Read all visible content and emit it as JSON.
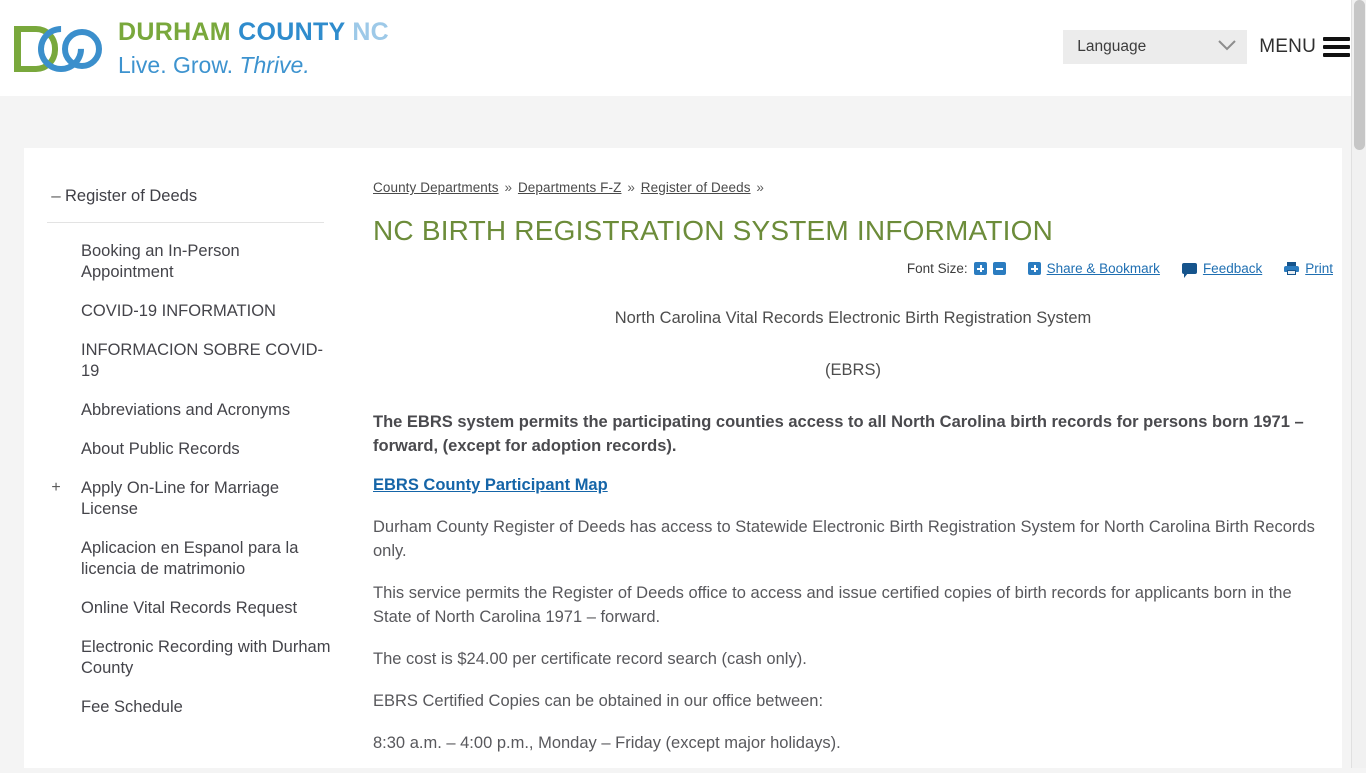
{
  "header": {
    "logo": {
      "mark_alt": "durham-county-dco-logo",
      "line1_part1": "DURHAM ",
      "line1_part2": "COUNTY ",
      "line1_part3": "NC",
      "line2_part1": "Live. Grow. ",
      "line2_part2": "Thrive."
    },
    "language_select": {
      "label": "Language",
      "icon": "chevron-down-icon"
    },
    "menu": {
      "label": "MENU",
      "icon": "hamburger-icon"
    }
  },
  "sidebar": {
    "root": {
      "toggle": "–",
      "label": "Register of Deeds"
    },
    "items": [
      {
        "label": "Booking an In-Person Appointment",
        "toggle": ""
      },
      {
        "label": "COVID-19 INFORMATION",
        "toggle": ""
      },
      {
        "label": "INFORMACION SOBRE COVID-19",
        "toggle": ""
      },
      {
        "label": "Abbreviations and Acronyms",
        "toggle": ""
      },
      {
        "label": "About Public Records",
        "toggle": ""
      },
      {
        "label": "Apply On-Line for Marriage License",
        "toggle": "+"
      },
      {
        "label": "Aplicacion en Espanol para la licencia de matrimonio",
        "toggle": ""
      },
      {
        "label": "Online Vital Records Request",
        "toggle": ""
      },
      {
        "label": "Electronic Recording with Durham County",
        "toggle": ""
      },
      {
        "label": "Fee Schedule",
        "toggle": ""
      }
    ]
  },
  "main": {
    "breadcrumb": {
      "items": [
        "County Departments",
        "Departments F-Z",
        "Register of Deeds"
      ],
      "separator": "»"
    },
    "title": "NC BIRTH REGISTRATION SYSTEM INFORMATION",
    "tools": {
      "font_size_label": "Font Size:",
      "increase_icon": "font-size-increase-icon",
      "decrease_icon": "font-size-decrease-icon",
      "share_icon": "share-plus-icon",
      "share_label": "Share & Bookmark",
      "feedback_icon": "feedback-speech-bubble-icon",
      "feedback_label": "Feedback",
      "print_icon": "printer-icon",
      "print_label": "Print"
    },
    "heading_center_1": "North Carolina Vital Records Electronic Birth Registration System",
    "heading_center_2": "(EBRS)",
    "paragraphs": [
      {
        "style": "bold",
        "text": "The EBRS system permits the participating counties access to all North Carolina birth records for persons born 1971 – forward, (except for adoption records)."
      },
      {
        "style": "link",
        "text": "EBRS County Participant Map"
      },
      {
        "style": "normal",
        "text": "Durham County Register of Deeds has access to Statewide Electronic Birth Registration System for North Carolina Birth Records only."
      },
      {
        "style": "normal",
        "text": "This service permits the Register of Deeds office to access and issue certified copies of birth records for applicants born in the State of North Carolina 1971 – forward."
      },
      {
        "style": "normal",
        "text": "The cost is $24.00 per certificate record search (cash only)."
      },
      {
        "style": "normal",
        "text": "EBRS Certified Copies can be obtained in our office between:"
      },
      {
        "style": "normal",
        "text": "8:30 a.m. – 4:00 p.m., Monday – Friday (except major holidays)."
      }
    ]
  },
  "colors": {
    "brand_green": "#79a83c",
    "brand_blue": "#2f8ccd",
    "brand_light_blue": "#9dc9e8",
    "title_green": "#6c8c3a",
    "link_blue": "#1565a8",
    "page_bg": "#f4f4f4"
  }
}
